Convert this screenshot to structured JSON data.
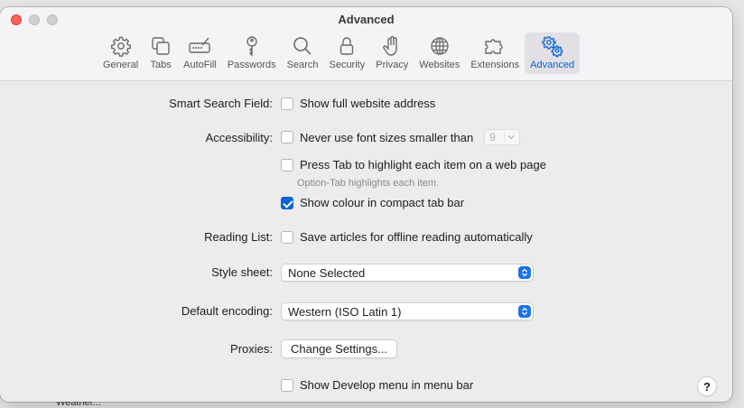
{
  "window": {
    "title": "Advanced"
  },
  "toolbar": {
    "tabs": [
      {
        "label": "General",
        "icon": "gear-icon"
      },
      {
        "label": "Tabs",
        "icon": "tabs-icon"
      },
      {
        "label": "AutoFill",
        "icon": "autofill-icon"
      },
      {
        "label": "Passwords",
        "icon": "key-icon"
      },
      {
        "label": "Search",
        "icon": "search-icon"
      },
      {
        "label": "Security",
        "icon": "lock-icon"
      },
      {
        "label": "Privacy",
        "icon": "hand-icon"
      },
      {
        "label": "Websites",
        "icon": "globe-icon"
      },
      {
        "label": "Extensions",
        "icon": "puzzle-icon"
      },
      {
        "label": "Advanced",
        "icon": "gears-icon",
        "active": true
      }
    ],
    "accent": "#0a64d6"
  },
  "settings": {
    "smart_search": {
      "label": "Smart Search Field:",
      "option": "Show full website address",
      "checked": false
    },
    "accessibility": {
      "label": "Accessibility:",
      "font_option": "Never use font sizes smaller than",
      "font_checked": false,
      "font_size_value": "9",
      "tab_option": "Press Tab to highlight each item on a web page",
      "tab_checked": false,
      "tab_hint": "Option-Tab highlights each item.",
      "colour_option": "Show colour in compact tab bar",
      "colour_checked": true
    },
    "reading_list": {
      "label": "Reading List:",
      "option": "Save articles for offline reading automatically",
      "checked": false
    },
    "style_sheet": {
      "label": "Style sheet:",
      "value": "None Selected"
    },
    "encoding": {
      "label": "Default encoding:",
      "value": "Western (ISO Latin 1)"
    },
    "proxies": {
      "label": "Proxies:",
      "button": "Change Settings..."
    },
    "develop": {
      "option": "Show Develop menu in menu bar",
      "checked": false
    }
  },
  "help": {
    "label": "?"
  },
  "background_window": {
    "text": "Weather..."
  }
}
